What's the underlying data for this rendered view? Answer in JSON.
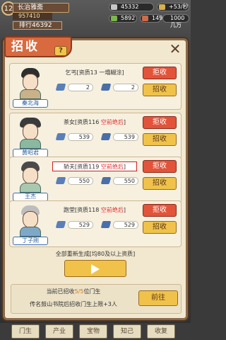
{
  "hud": {
    "level": "12",
    "academy_name": "长治雅斋",
    "academy_sub": "957410",
    "rank_label": "排行46392",
    "res_top_center": "45332",
    "res_top_right": "+53/秒",
    "res_mid_left": "5892",
    "res_mid_center": "149",
    "res_mid_right": "1000几万"
  },
  "dialog": {
    "title": "招收",
    "help": "?",
    "close": "✕",
    "reject_label": "拒收",
    "recruit_label": "招收",
    "cards": [
      {
        "name": "秦北海",
        "info_prefix": "乞丐[资质13",
        "info_suffix": " 一塌糊涂]",
        "info_highlight": "",
        "stat1": "2",
        "stat2": "2"
      },
      {
        "name": "黄昭君",
        "info_prefix": "茶女[资质116",
        "info_suffix": "]",
        "info_highlight": " 空前绝后",
        "stat1": "539",
        "stat2": "539"
      },
      {
        "name": "王杰",
        "info_prefix": "轿夫[资质119",
        "info_suffix": "]",
        "info_highlight": " 空前绝后",
        "stat1": "550",
        "stat2": "550"
      },
      {
        "name": "丁子刚",
        "info_prefix": "跑堂[资质118",
        "info_suffix": "]",
        "info_highlight": " 空前绝后",
        "stat1": "529",
        "stat2": "529"
      }
    ],
    "regen_text": "全部重新生成[均80及以上资质]",
    "recruited_prefix": "当前已招收",
    "recruited_count": "5/5",
    "recruited_suffix": "位门生",
    "upgrade_text": "传名鼓山书院后招收门生上限+3人",
    "goto_label": "前往"
  },
  "nav": [
    "门生",
    "产业",
    "宝物",
    "知己",
    "收复"
  ]
}
